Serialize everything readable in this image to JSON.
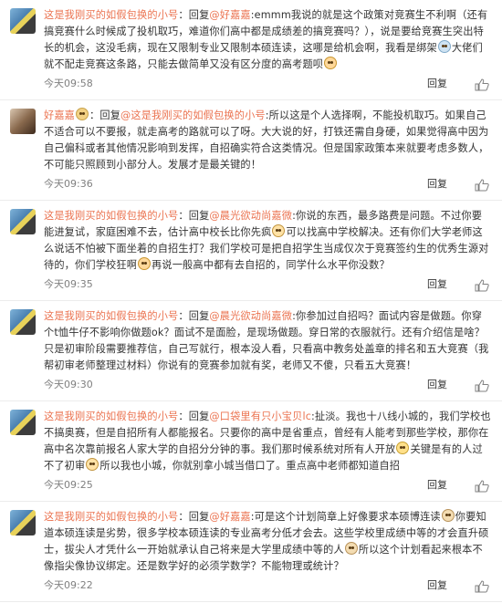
{
  "comments": [
    {
      "user": "这是我刚买的如假包换的小号",
      "user_emoji": "",
      "reply_prefix": "：回复",
      "mention": "@好嘉嘉",
      "segments": [
        {
          "t": "text",
          "v": ":emmm我说的就是这个政策对竞赛生不利啊（还有搞竞赛什么时候成了投机取巧，难道你们高中都是成绩差的搞竞赛吗？），说是要给竞赛生突出特长的机会，这没毛病，现在又限制专业又限制本硕连读，这哪是给机会啊，我看是绑架"
        },
        {
          "t": "emo",
          "v": "cry-emoji"
        },
        {
          "t": "text",
          "v": "大佬们就不配走竞赛这条路，只能去做简单又没有区分度的高考题呗"
        },
        {
          "t": "emo",
          "v": "sad-emoji"
        }
      ],
      "time": "今天09:58",
      "reply_label": "回复"
    },
    {
      "user": "好嘉嘉",
      "user_emoji": "laugh-emoji",
      "reply_prefix": "：回复",
      "mention": "@这是我刚买的如假包换的小号",
      "segments": [
        {
          "t": "text",
          "v": ":所以这是个人选择啊，不能投机取巧。如果自己不适合可以不要报，就走高考的路就可以了呀。大大说的好，打铁还需自身硬，如果觉得高中因为自己偏科或者其他情况影响到发挥，自招确实符合这类情况。但是国家政策本来就要考虑多数人，不可能只照顾到小部分人。发展才是最关键的！"
        }
      ],
      "time": "今天09:36",
      "reply_label": "回复"
    },
    {
      "user": "这是我刚买的如假包换的小号",
      "user_emoji": "",
      "reply_prefix": "：回复",
      "mention": "@晨光欲动尚嘉微",
      "segments": [
        {
          "t": "text",
          "v": ":你说的东西，最多路费是问题。不过你要能进复试，家庭困难不去，估计高中校长比你先疯"
        },
        {
          "t": "emo",
          "v": "sweat-emoji"
        },
        {
          "t": "text",
          "v": "可以找高中学校解决。还有你们大学老师这么说话不怕被下面坐着的自招生打？我们学校可是把自招学生当成仅次于竞赛签约生的优秀生源对待的，你们学校狂啊"
        },
        {
          "t": "emo",
          "v": "sad-emoji"
        },
        {
          "t": "text",
          "v": "再说一般高中都有去自招的，同学什么水平你没数？"
        }
      ],
      "time": "今天09:35",
      "reply_label": "回复"
    },
    {
      "user": "这是我刚买的如假包换的小号",
      "user_emoji": "",
      "reply_prefix": "：回复",
      "mention": "@晨光欲动尚嘉微",
      "segments": [
        {
          "t": "text",
          "v": ":你参加过自招吗？面试内容是做题。你穿个t恤牛仔不影响你做题ok？面试不是面脸，是现场做题。穿日常的衣服就行。还有介绍信是啥？只是初审阶段需要推荐信，自己写就行，根本没人看，只看高中教务处盖章的排名和五大竞赛（我帮初审老师整理过材料）你说有的竞赛参加就有奖，老师又不傻，只看五大竞赛！"
        }
      ],
      "time": "今天09:30",
      "reply_label": "回复"
    },
    {
      "user": "这是我刚买的如假包换的小号",
      "user_emoji": "",
      "reply_prefix": "：回复",
      "mention": "@口袋里有只小宝贝lc",
      "segments": [
        {
          "t": "text",
          "v": ":扯淡。我也十八线小城的，我们学校也不搞奥赛，但是自招所有人都能报名。只要你的高中是省重点，曾经有人能考到那些学校，那你在高中名次靠前报名人家大学的自招分分钟的事。我们那时候系统对所有人开放"
        },
        {
          "t": "emo",
          "v": "v-emoji"
        },
        {
          "t": "text",
          "v": "关键是有的人过不了初审"
        },
        {
          "t": "emo",
          "v": "sweat-emoji"
        },
        {
          "t": "text",
          "v": "所以我也小城，你就别拿小城当借口了。重点高中老师都知道自招"
        }
      ],
      "time": "今天09:25",
      "reply_label": "回复"
    },
    {
      "user": "这是我刚买的如假包换的小号",
      "user_emoji": "",
      "reply_prefix": "：回复",
      "mention": "@好嘉嘉",
      "segments": [
        {
          "t": "text",
          "v": ":可是这个计划简章上好像要求本硕博连读"
        },
        {
          "t": "emo",
          "v": "think-emoji"
        },
        {
          "t": "text",
          "v": "你要知道本硕连读是劣势，很多学校本硕连读的专业高考分低才会去。这些学校里成绩中等的才会直升硕士，拔尖人才凭什么一开始就承认自己将来是大学里成绩中等的人"
        },
        {
          "t": "emo",
          "v": "think-emoji"
        },
        {
          "t": "text",
          "v": "所以这个计划看起来根本不像指尖像协议绑定。还是数学好的必须学数学？不能物理或统计？"
        }
      ],
      "time": "今天09:22",
      "reply_label": "回复"
    }
  ],
  "colors": {
    "username": "#eb7350",
    "text": "#333333",
    "time": "#808080",
    "divider": "#ececec"
  }
}
